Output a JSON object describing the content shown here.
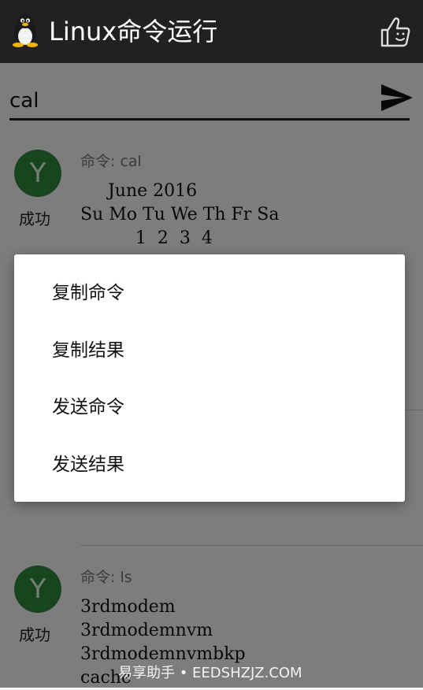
{
  "app": {
    "title": "Linux命令运行"
  },
  "input": {
    "value": "cal"
  },
  "cards": [
    {
      "avatar": "Y",
      "status": "成功",
      "command": "命令: cal",
      "output": "     June 2016\nSu Mo Tu We Th Fr Sa\n          1  2  3  4"
    },
    {
      "avatar": "Y",
      "status": "成功",
      "command": "命令: ls",
      "output": "3rdmodem\n3rdmodemnvm\n3rdmodemnvmbkp\ncache"
    }
  ],
  "menu": {
    "items": [
      "复制命令",
      "复制结果",
      "发送命令",
      "发送结果"
    ]
  },
  "watermark": "易享助手 • EEDSHZJZ.COM",
  "colors": {
    "appbar": "#212121",
    "avatar": "#2e8b3c"
  },
  "icons": {
    "logo": "tux-logo-icon",
    "like": "thumbs-up-icon",
    "send": "send-icon"
  }
}
